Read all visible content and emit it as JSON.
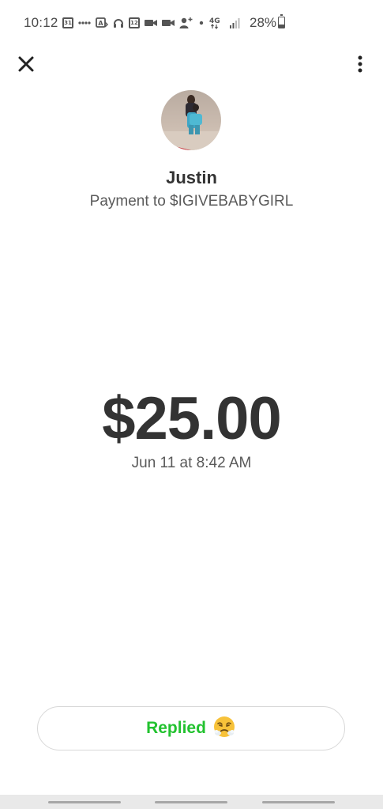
{
  "status_bar": {
    "time": "10:12",
    "calendar_day": "31",
    "notif_badge": "12",
    "network": "4G",
    "battery_percent": "28%",
    "battery_level": 0.28
  },
  "header": {
    "close_icon": "close-icon",
    "more_icon": "more-vertical-icon"
  },
  "recipient": {
    "name": "Justin",
    "description": "Payment to $IGIVEBABYGIRL"
  },
  "payment": {
    "amount": "$25.00",
    "date": "Jun 11 at 8:42 AM"
  },
  "reply_button": {
    "label": "Replied",
    "emoji": "😤"
  },
  "colors": {
    "accent_green": "#22c22f",
    "text_primary": "#333333",
    "text_secondary": "#5a5a5a"
  }
}
